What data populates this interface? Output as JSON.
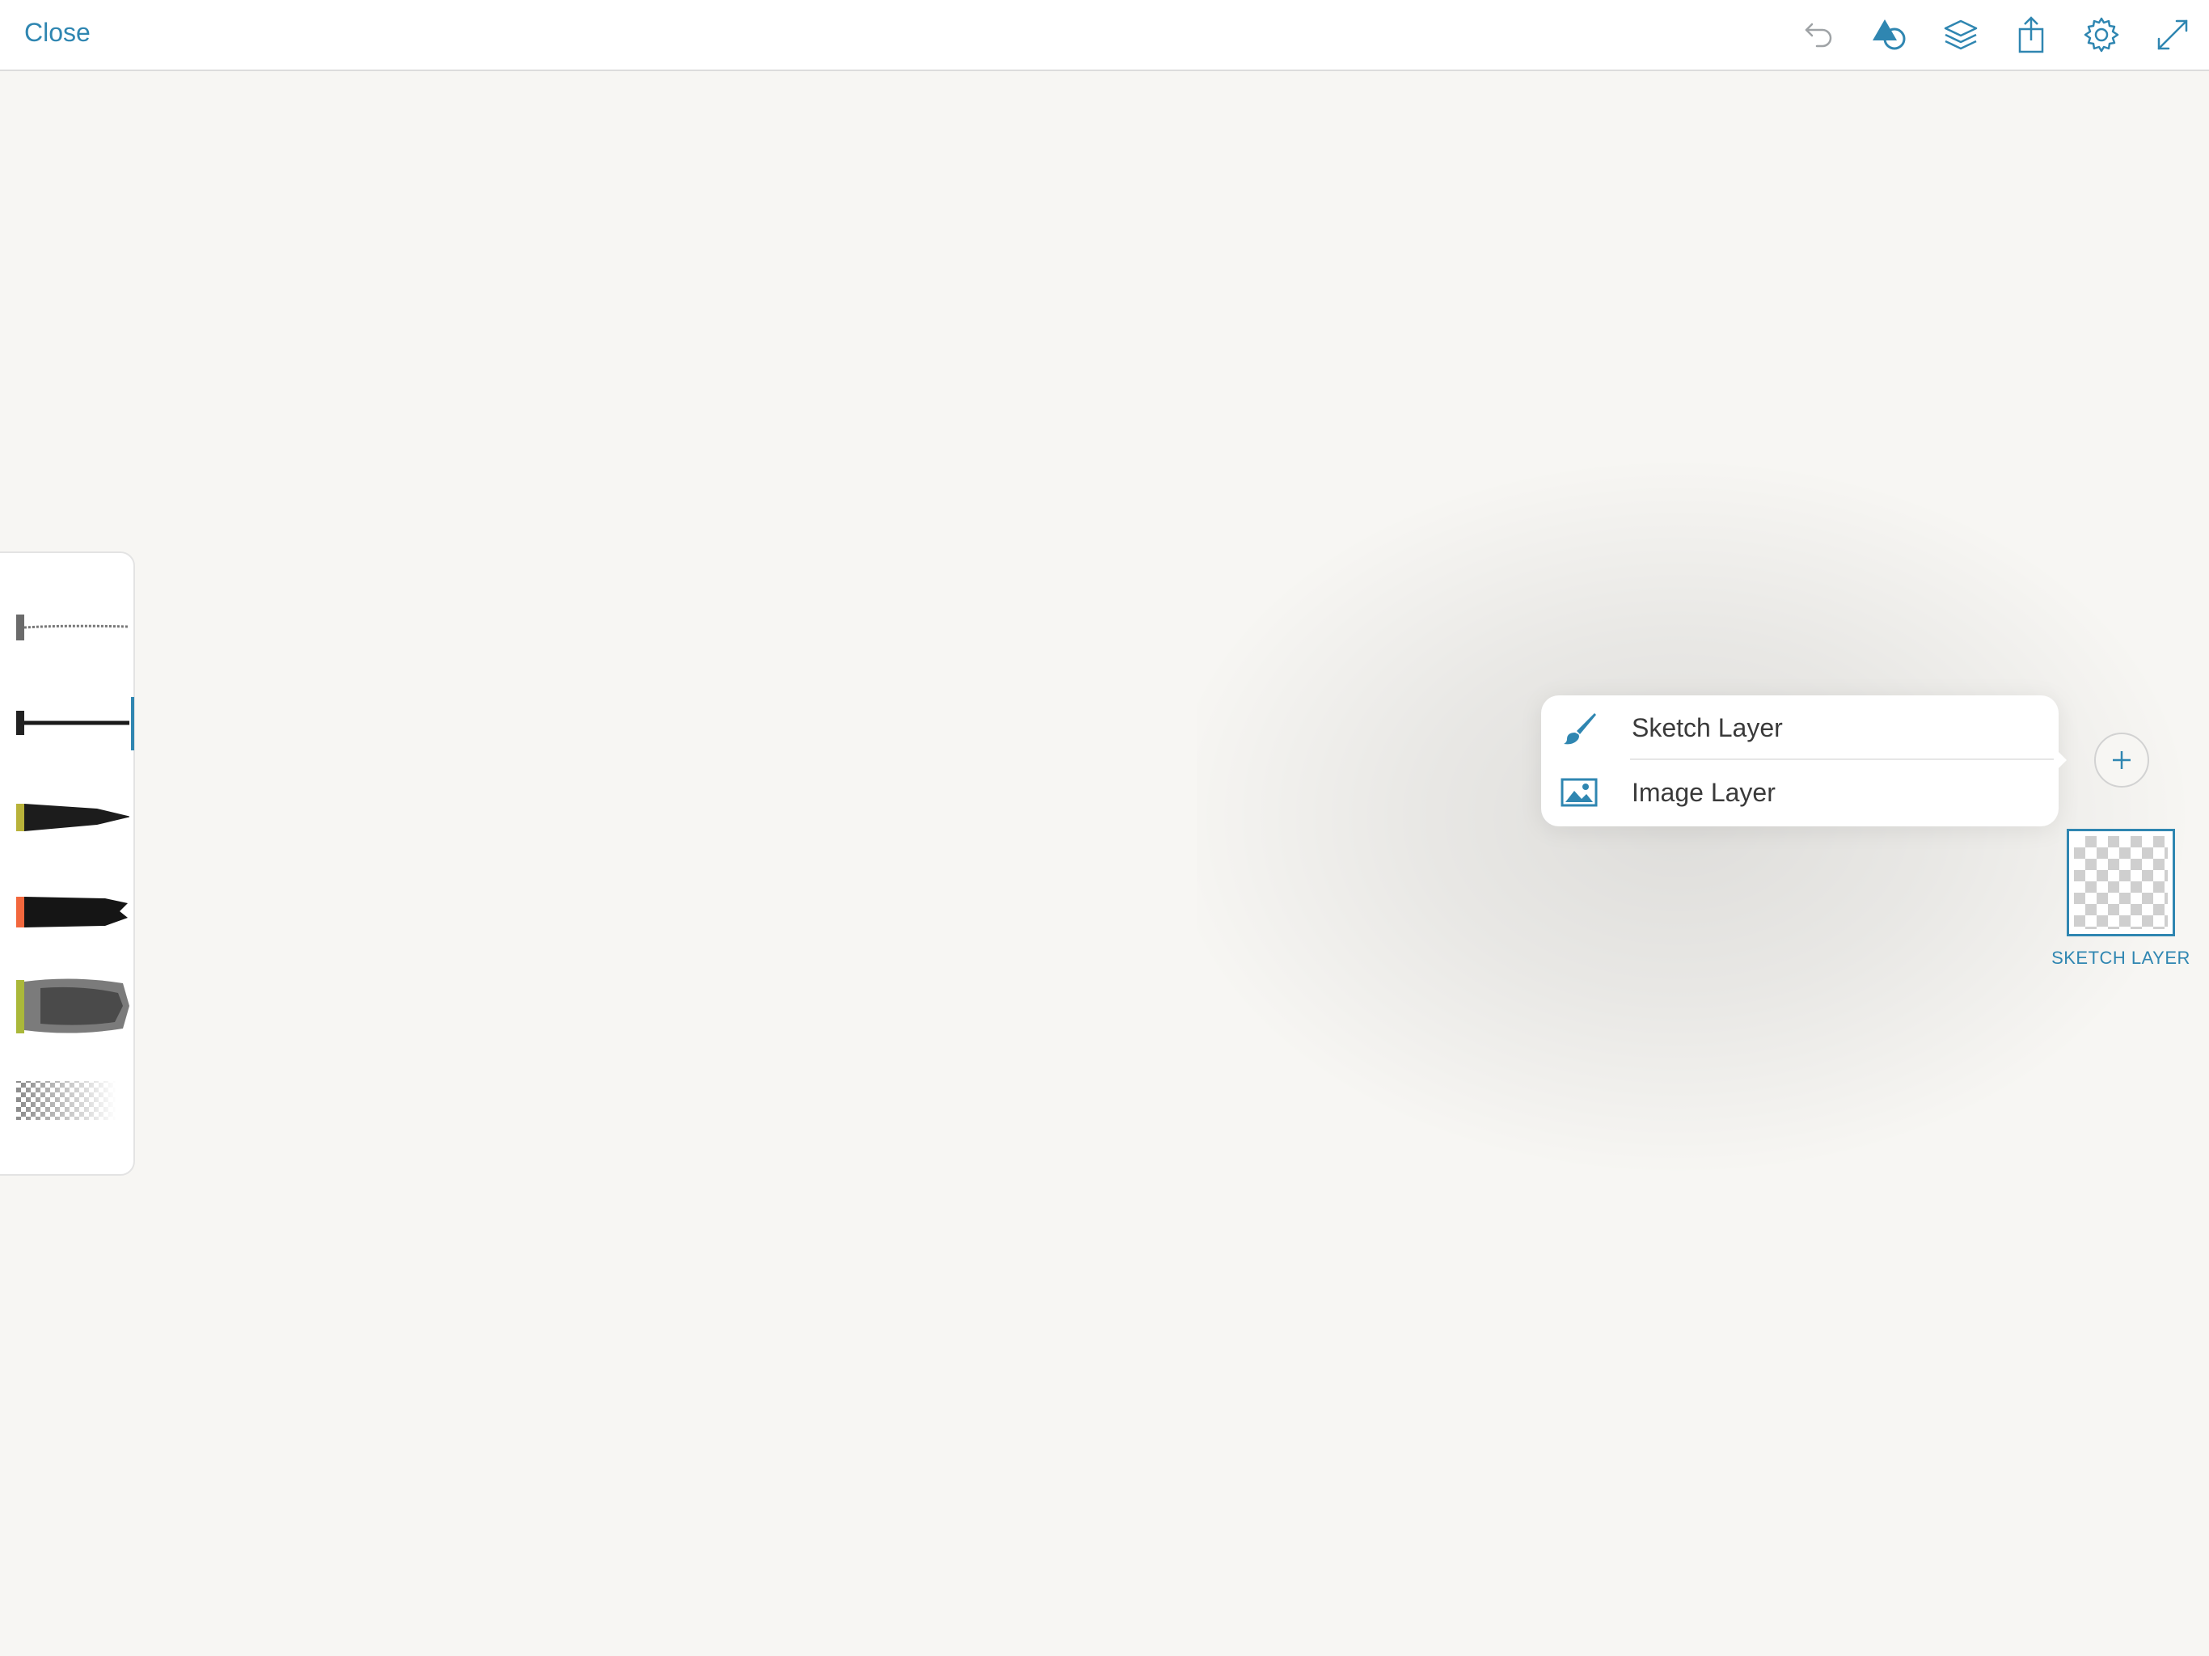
{
  "toolbar": {
    "close_label": "Close",
    "icons": [
      "undo-icon",
      "shapes-icon",
      "layers-icon",
      "share-icon",
      "gear-icon",
      "expand-icon"
    ]
  },
  "colors": {
    "accent": "#2f86b1",
    "canvas": "#f7f6f3",
    "brush_swatches": [
      "#6b6b6b",
      "#222222",
      "#b8b23a",
      "#f2673d",
      "#aab83a"
    ]
  },
  "brushes": [
    {
      "name": "pencil",
      "swatch": "#6b6b6b"
    },
    {
      "name": "ink-pen",
      "swatch": "#222222",
      "selected": true
    },
    {
      "name": "marker",
      "swatch": "#b8b23a"
    },
    {
      "name": "brush",
      "swatch": "#f2673d"
    },
    {
      "name": "watercolor",
      "swatch": "#aab83a"
    },
    {
      "name": "eraser",
      "swatch": ""
    }
  ],
  "add_layer_menu": {
    "items": [
      {
        "label": "Sketch Layer",
        "icon": "brush-icon"
      },
      {
        "label": "Image Layer",
        "icon": "image-icon"
      }
    ]
  },
  "layers": [
    {
      "label": "SKETCH LAYER",
      "selected": true
    }
  ]
}
